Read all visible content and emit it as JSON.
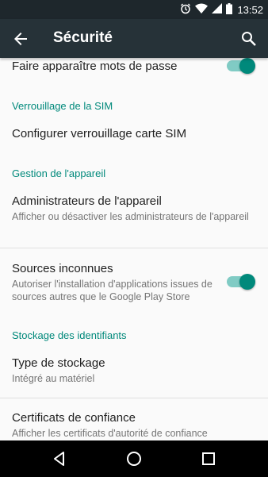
{
  "status_bar": {
    "time": "13:52",
    "icons": [
      "alarm-icon",
      "wifi-icon",
      "signal-icon",
      "battery-icon"
    ]
  },
  "app_bar": {
    "title": "Sécurité",
    "back_icon": "arrow-back-icon",
    "search_icon": "search-icon"
  },
  "settings": {
    "show_passwords": {
      "title": "Faire apparaître mots de passe",
      "enabled": true
    },
    "sim_lock": {
      "category": "Verrouillage de la SIM",
      "item_title": "Configurer verrouillage carte SIM"
    },
    "device_admin": {
      "category": "Gestion de l'appareil",
      "item_title": "Administrateurs de l'appareil",
      "item_subtitle": "Afficher ou désactiver les administrateurs de l'appareil"
    },
    "unknown_sources": {
      "title": "Sources inconnues",
      "subtitle": "Autoriser l'installation d'applications issues de sources autres que le Google Play Store",
      "enabled": true
    },
    "credential_storage": {
      "category": "Stockage des identifiants",
      "storage_type": {
        "title": "Type de stockage",
        "subtitle": "Intégré au matériel"
      },
      "trusted_certs": {
        "title": "Certificats de confiance",
        "subtitle": "Afficher les certificats d'autorité de confiance"
      }
    }
  },
  "colors": {
    "app_bar": "#263238",
    "status_bar": "#1e272c",
    "accent": "#00897b",
    "switch_track": "#80cbc4"
  },
  "nav_bar": {
    "icons": [
      "back-triangle-icon",
      "home-circle-icon",
      "recents-square-icon"
    ]
  }
}
